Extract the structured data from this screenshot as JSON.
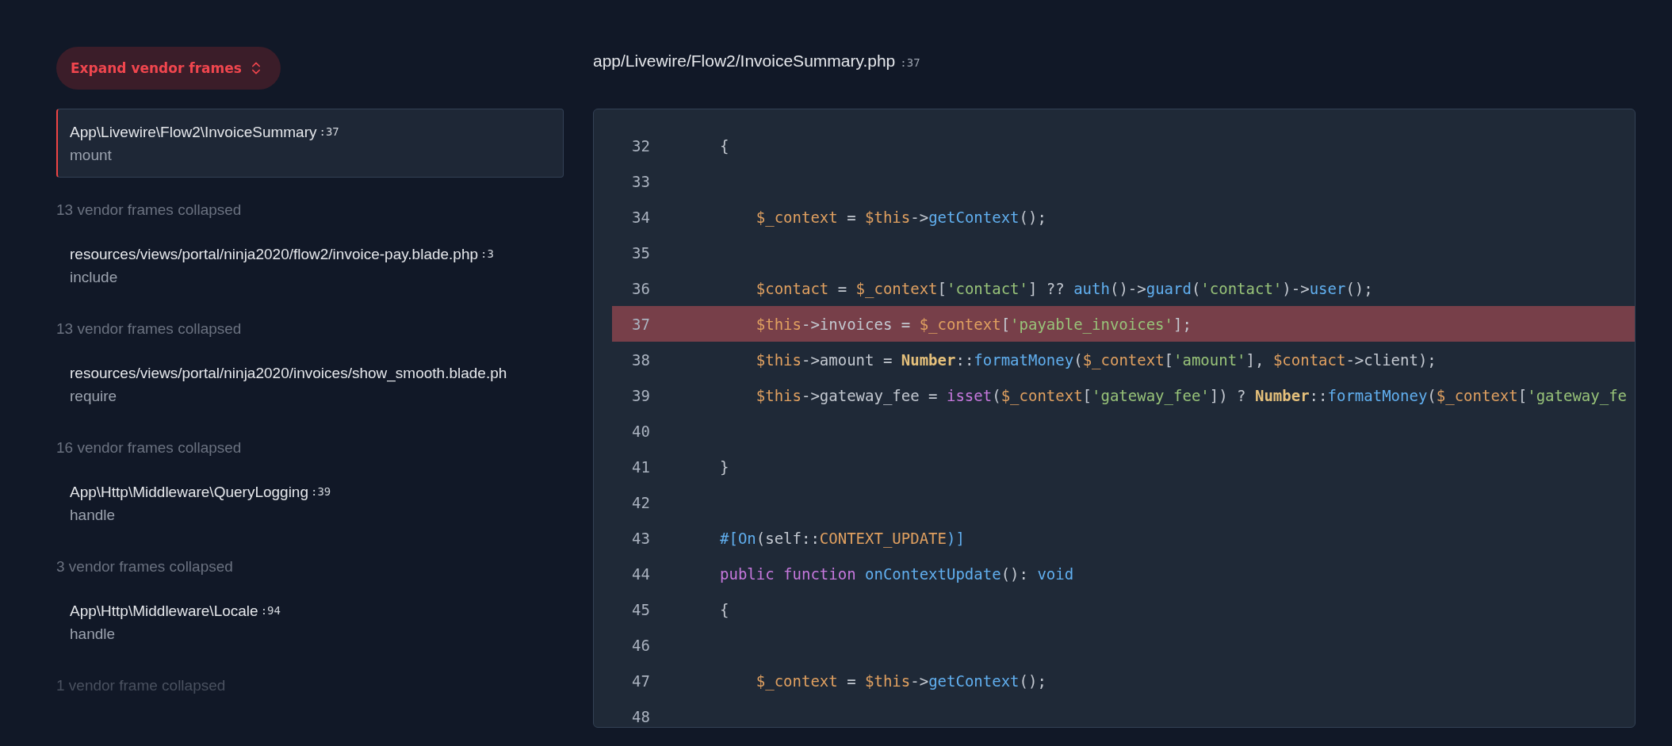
{
  "expand_button": {
    "label": "Expand vendor frames"
  },
  "frames": [
    {
      "kind": "frame",
      "path": "App\\Livewire\\Flow2\\InvoiceSummary",
      "line": ":37",
      "method": "mount",
      "selected": true
    },
    {
      "kind": "collapsed",
      "text": "13 vendor frames collapsed"
    },
    {
      "kind": "frame",
      "path": "resources/views/portal/ninja2020/flow2/invoice-pay.blade.php",
      "line": ":3",
      "method": "include",
      "selected": false
    },
    {
      "kind": "collapsed",
      "text": "13 vendor frames collapsed"
    },
    {
      "kind": "frame",
      "path": "resources/views/portal/ninja2020/invoices/show_smooth.blade.ph",
      "method": "require",
      "selected": false
    },
    {
      "kind": "collapsed",
      "text": "16 vendor frames collapsed"
    },
    {
      "kind": "frame",
      "path": "App\\Http\\Middleware\\QueryLogging",
      "line": ":39",
      "method": "handle",
      "selected": false
    },
    {
      "kind": "collapsed",
      "text": "3 vendor frames collapsed"
    },
    {
      "kind": "frame",
      "path": "App\\Http\\Middleware\\Locale",
      "line": ":94",
      "method": "handle",
      "selected": false
    },
    {
      "kind": "collapsed",
      "text": "1 vendor frame collapsed"
    }
  ],
  "file": {
    "path": "app/Livewire/Flow2/InvoiceSummary.php",
    "line": ":37"
  },
  "code": [
    {
      "number": "32",
      "highlighted": false,
      "tokens": [
        {
          "kind": "plain",
          "text": "{"
        }
      ]
    },
    {
      "number": "33",
      "highlighted": false
    },
    {
      "number": "34",
      "highlighted": false,
      "tokens": [
        {
          "kind": "var",
          "text": "    $_context"
        },
        {
          "kind": "plain",
          "text": " = "
        },
        {
          "kind": "var",
          "text": "$this"
        },
        {
          "kind": "plain",
          "text": "->"
        },
        {
          "kind": "fn",
          "text": "getContext"
        },
        {
          "kind": "plain",
          "text": "();"
        }
      ]
    },
    {
      "number": "35",
      "highlighted": false
    },
    {
      "number": "36",
      "highlighted": false,
      "tokens": [
        {
          "kind": "var",
          "text": "    $contact"
        },
        {
          "kind": "plain",
          "text": " = "
        },
        {
          "kind": "var",
          "text": "$_context"
        },
        {
          "kind": "plain",
          "text": "["
        },
        {
          "kind": "str",
          "text": "'contact'"
        },
        {
          "kind": "plain",
          "text": "] ?? "
        },
        {
          "kind": "fn",
          "text": "auth"
        },
        {
          "kind": "plain",
          "text": "()->"
        },
        {
          "kind": "fn",
          "text": "guard"
        },
        {
          "kind": "plain",
          "text": "("
        },
        {
          "kind": "str",
          "text": "'contact'"
        },
        {
          "kind": "plain",
          "text": ")->"
        },
        {
          "kind": "fn",
          "text": "user"
        },
        {
          "kind": "plain",
          "text": "();"
        }
      ]
    },
    {
      "number": "37",
      "highlighted": true,
      "tokens": [
        {
          "kind": "var",
          "text": "    $this"
        },
        {
          "kind": "plain",
          "text": "->invoices = "
        },
        {
          "kind": "var",
          "text": "$_context"
        },
        {
          "kind": "plain",
          "text": "["
        },
        {
          "kind": "str",
          "text": "'payable_invoices'"
        },
        {
          "kind": "plain",
          "text": "];"
        }
      ]
    },
    {
      "number": "38",
      "highlighted": false,
      "tokens": [
        {
          "kind": "var",
          "text": "    $this"
        },
        {
          "kind": "plain",
          "text": "->amount = "
        },
        {
          "kind": "cls",
          "text": "Number"
        },
        {
          "kind": "plain",
          "text": "::"
        },
        {
          "kind": "fn",
          "text": "formatMoney"
        },
        {
          "kind": "plain",
          "text": "("
        },
        {
          "kind": "var",
          "text": "$_context"
        },
        {
          "kind": "plain",
          "text": "["
        },
        {
          "kind": "str",
          "text": "'amount'"
        },
        {
          "kind": "plain",
          "text": "], "
        },
        {
          "kind": "var",
          "text": "$contact"
        },
        {
          "kind": "plain",
          "text": "->client);"
        }
      ]
    },
    {
      "number": "39",
      "highlighted": false,
      "tokens": [
        {
          "kind": "var",
          "text": "    $this"
        },
        {
          "kind": "plain",
          "text": "->gateway_fee = "
        },
        {
          "kind": "kw",
          "text": "isset"
        },
        {
          "kind": "plain",
          "text": "("
        },
        {
          "kind": "var",
          "text": "$_context"
        },
        {
          "kind": "plain",
          "text": "["
        },
        {
          "kind": "str",
          "text": "'gateway_fee'"
        },
        {
          "kind": "plain",
          "text": "]) ? "
        },
        {
          "kind": "cls",
          "text": "Number"
        },
        {
          "kind": "plain",
          "text": "::"
        },
        {
          "kind": "fn",
          "text": "formatMoney"
        },
        {
          "kind": "plain",
          "text": "("
        },
        {
          "kind": "var",
          "text": "$_context"
        },
        {
          "kind": "plain",
          "text": "["
        },
        {
          "kind": "str",
          "text": "'gateway_fe"
        }
      ]
    },
    {
      "number": "40",
      "highlighted": false
    },
    {
      "number": "41",
      "highlighted": false,
      "tokens": [
        {
          "kind": "plain",
          "text": "}"
        }
      ]
    },
    {
      "number": "42",
      "highlighted": false
    },
    {
      "number": "43",
      "highlighted": false,
      "tokens": [
        {
          "kind": "fn",
          "text": "#[On"
        },
        {
          "kind": "plain",
          "text": "(self::"
        },
        {
          "kind": "var",
          "text": "CONTEXT_UPDATE"
        },
        {
          "kind": "fn",
          "text": ")]"
        }
      ]
    },
    {
      "number": "44",
      "highlighted": false,
      "tokens": [
        {
          "kind": "kw",
          "text": "public function "
        },
        {
          "kind": "fn",
          "text": "onContextUpdate"
        },
        {
          "kind": "plain",
          "text": "(): "
        },
        {
          "kind": "fn",
          "text": "void"
        }
      ]
    },
    {
      "number": "45",
      "highlighted": false,
      "tokens": [
        {
          "kind": "plain",
          "text": "{"
        }
      ]
    },
    {
      "number": "46",
      "highlighted": false
    },
    {
      "number": "47",
      "highlighted": false,
      "tokens": [
        {
          "kind": "var",
          "text": "    $_context"
        },
        {
          "kind": "plain",
          "text": " = "
        },
        {
          "kind": "var",
          "text": "$this"
        },
        {
          "kind": "plain",
          "text": "->"
        },
        {
          "kind": "fn",
          "text": "getContext"
        },
        {
          "kind": "plain",
          "text": "();"
        }
      ]
    },
    {
      "number": "48",
      "highlighted": false
    }
  ]
}
